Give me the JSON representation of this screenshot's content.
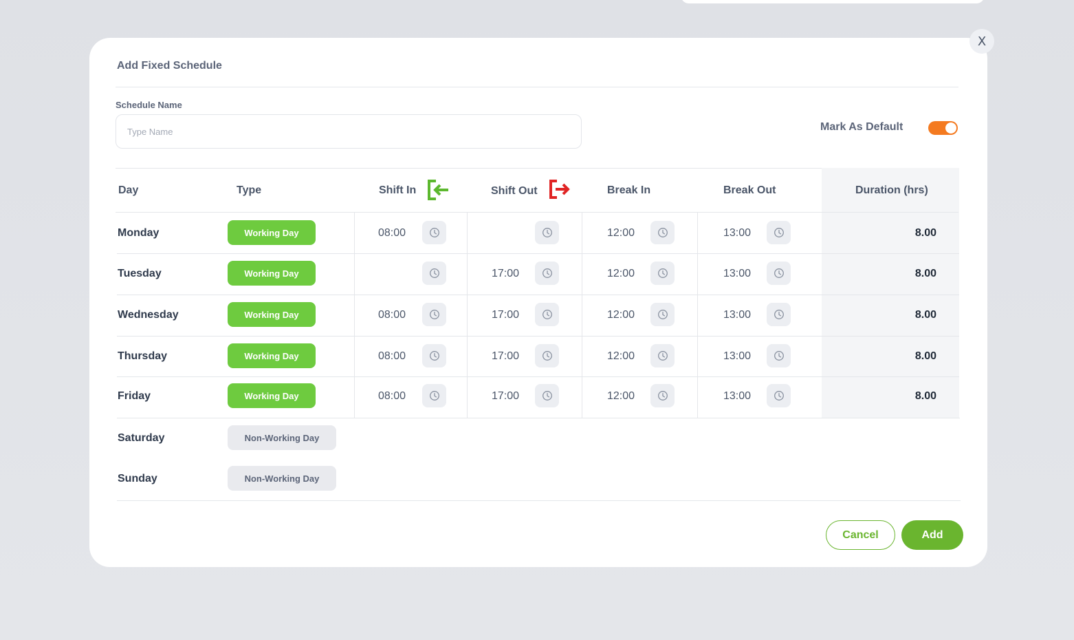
{
  "modal": {
    "title": "Add Fixed Schedule",
    "close_label": "X",
    "name_label": "Schedule Name",
    "name_placeholder": "Type Name",
    "default_label": "Mark As Default",
    "default_on": true,
    "toggle_color": "#f47a20"
  },
  "table": {
    "headers": {
      "day": "Day",
      "type": "Type",
      "shift_in": "Shift In",
      "shift_out": "Shift Out",
      "break_in": "Break In",
      "break_out": "Break Out",
      "duration": "Duration (hrs)"
    },
    "header_icons": {
      "shift_in": "sign-in-icon",
      "shift_out": "sign-out-icon"
    },
    "rows": [
      {
        "day": "Monday",
        "type": "Working Day",
        "shift_in": "08:00",
        "shift_out": "",
        "break_in": "12:00",
        "break_out": "13:00",
        "duration": "8.00"
      },
      {
        "day": "Tuesday",
        "type": "Working Day",
        "shift_in": "",
        "shift_out": "17:00",
        "break_in": "12:00",
        "break_out": "13:00",
        "duration": "8.00"
      },
      {
        "day": "Wednesday",
        "type": "Working Day",
        "shift_in": "08:00",
        "shift_out": "17:00",
        "break_in": "12:00",
        "break_out": "13:00",
        "duration": "8.00"
      },
      {
        "day": "Thursday",
        "type": "Working Day",
        "shift_in": "08:00",
        "shift_out": "17:00",
        "break_in": "12:00",
        "break_out": "13:00",
        "duration": "8.00"
      },
      {
        "day": "Friday",
        "type": "Working Day",
        "shift_in": "08:00",
        "shift_out": "17:00",
        "break_in": "12:00",
        "break_out": "13:00",
        "duration": "8.00"
      },
      {
        "day": "Saturday",
        "type": "Non-Working Day"
      },
      {
        "day": "Sunday",
        "type": "Non-Working Day"
      }
    ]
  },
  "actions": {
    "cancel": "Cancel",
    "add": "Add"
  },
  "colors": {
    "working_badge": "#6ecb3f",
    "non_working_badge": "#e9eaee",
    "primary_green": "#6ab52f",
    "shift_in_icon": "#5cb82e",
    "shift_out_icon": "#e02424"
  }
}
